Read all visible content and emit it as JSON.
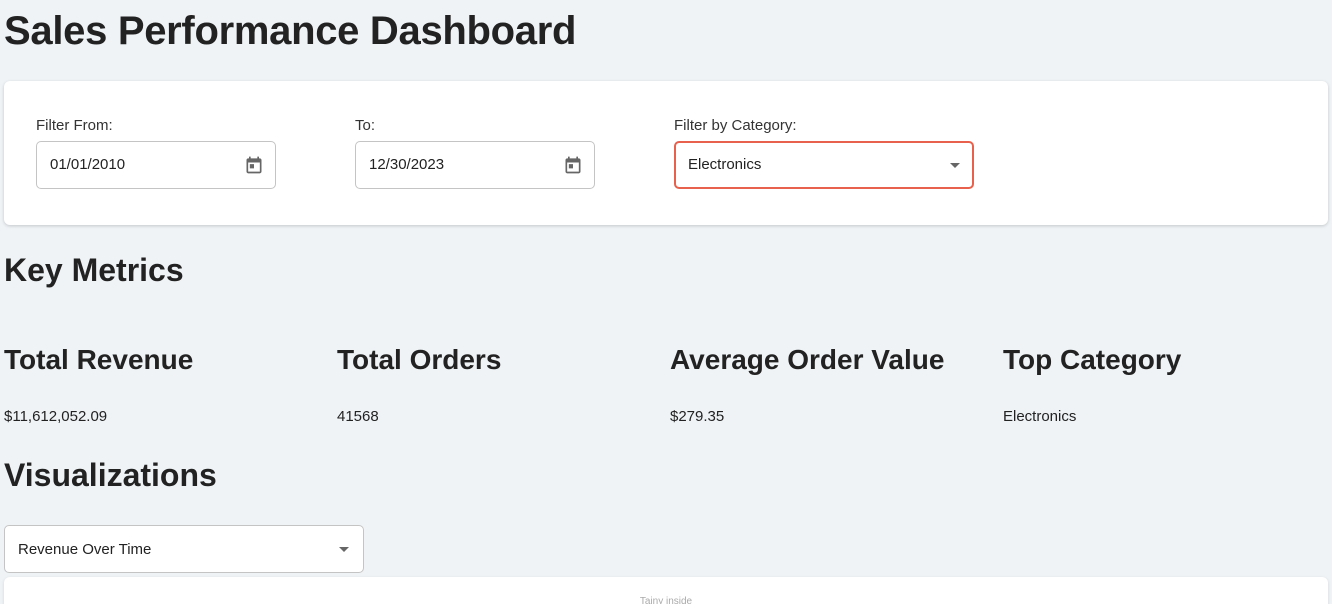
{
  "header": {
    "title": "Sales Performance Dashboard"
  },
  "filters": {
    "from": {
      "label": "Filter From:",
      "value": "01/01/2010",
      "icon": "calendar-icon"
    },
    "to": {
      "label": "To:",
      "value": "12/30/2023",
      "icon": "calendar-icon"
    },
    "category": {
      "label": "Filter by Category:",
      "value": "Electronics",
      "icon": "chevron-down-icon"
    }
  },
  "key_metrics": {
    "heading": "Key Metrics",
    "items": [
      {
        "title": "Total Revenue",
        "value": "$11,612,052.09"
      },
      {
        "title": "Total Orders",
        "value": "41568"
      },
      {
        "title": "Average Order Value",
        "value": "$279.35"
      },
      {
        "title": "Top Category",
        "value": "Electronics"
      }
    ]
  },
  "visualizations": {
    "heading": "Visualizations",
    "selected_chart": "Revenue Over Time",
    "chart_hint": "Tainy inside"
  },
  "colors": {
    "background": "#eff3f6",
    "card": "#ffffff",
    "accent_border": "#e8614c",
    "text": "#222222"
  }
}
